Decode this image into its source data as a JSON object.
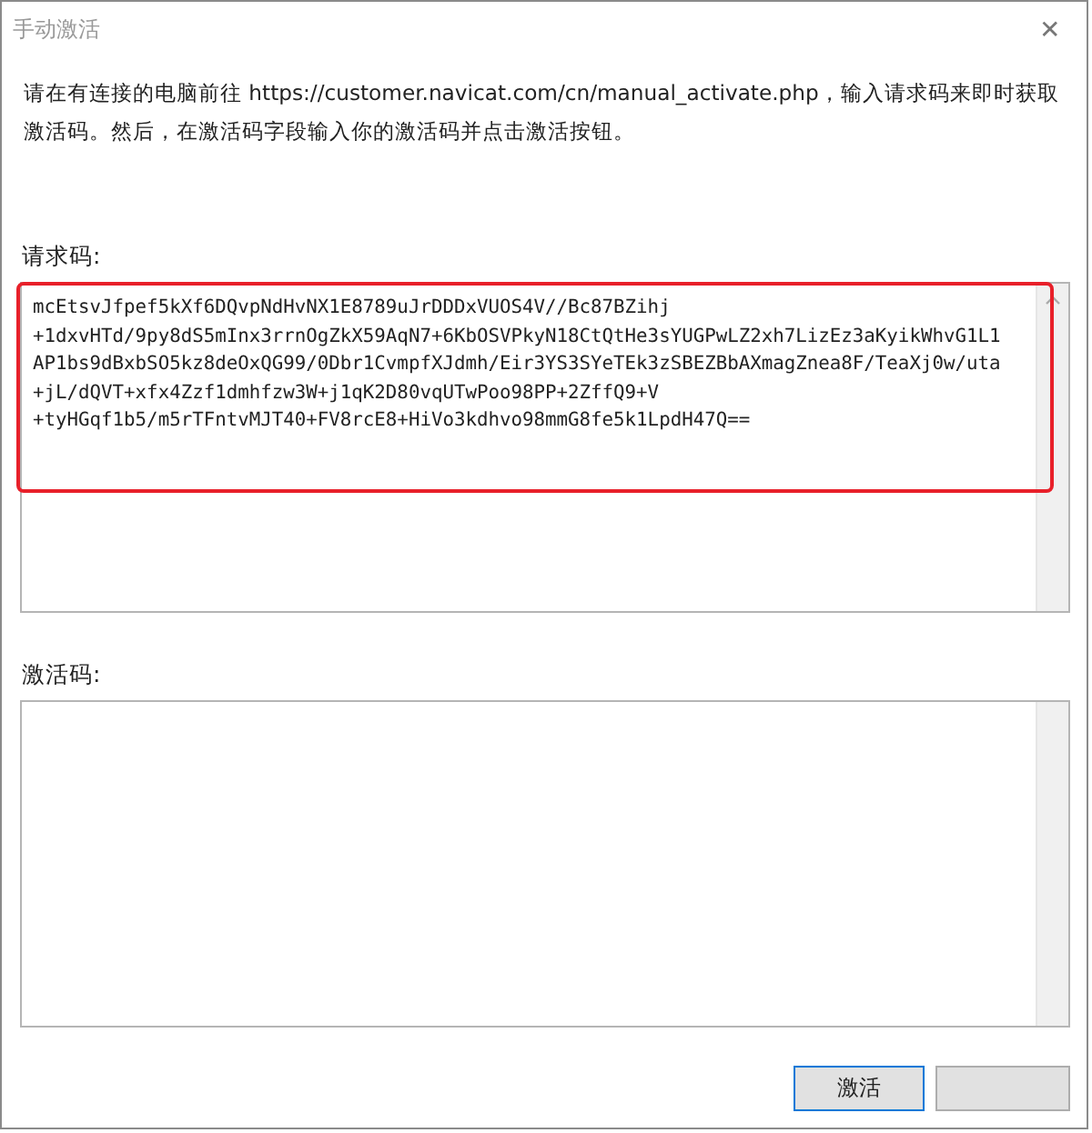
{
  "window": {
    "title": "手动激活",
    "close": "✕"
  },
  "instruction": "请在有连接的电脑前往 https://customer.navicat.com/cn/manual_activate.php，输入请求码来即时获取激活码。然后，在激活码字段输入你的激活码并点击激活按钮。",
  "request_code": {
    "label": "请求码:",
    "lines": [
      "mcEtsvJfpef5kXf6DQvpNdHvNX1E8789uJrDDDxVUOS4V//Bc87BZihj",
      "+1dxvHTd/9py8dS5mInx3rrnOgZkX59AqN7+6KbOSVPkyN18CtQtHe3sYUGPwLZ2xh7LizEz3aKyikWhvG1L1",
      "AP1bs9dBxbSO5kz8deOxQG99/0Dbr1CvmpfXJdmh/Eir3YS3SYeTEk3zSBEZBbAXmagZnea8F/TeaXj0w/uta",
      "+jL/dQVT+xfx4Zzf1dmhfzw3W+j1qK2D80vqUTwPoo98PP+2ZffQ9+V",
      "+tyHGqf1b5/m5rTFntvMJT40+FV8rcE8+HiVo3kdhvo98mmG8fe5k1LpdH47Q=="
    ],
    "highlighted": true
  },
  "activation_code": {
    "label": "激活码:"
  },
  "buttons": [
    {
      "label": "激活"
    }
  ]
}
